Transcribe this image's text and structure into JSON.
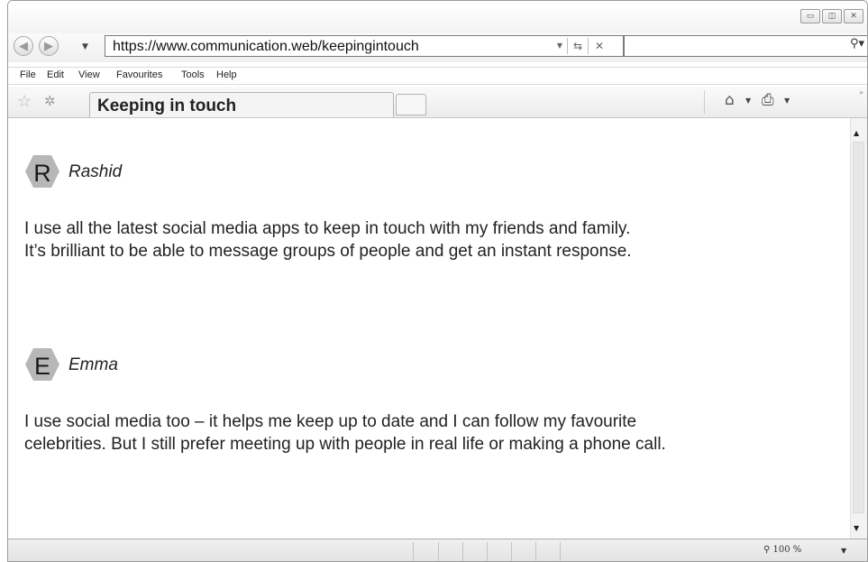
{
  "browser": {
    "address": {
      "url": "https://www.communication.web/keepingintouch",
      "search_value": ""
    },
    "menu": [
      "File",
      "Edit",
      "View",
      "Favourites",
      "Tools",
      "Help"
    ],
    "tab": {
      "title": "Keeping in touch"
    },
    "status": {
      "zoom": "100 %"
    },
    "icons": [
      "back-icon",
      "forward-icon",
      "dropdown-icon",
      "refresh-icon",
      "stop-icon",
      "search-icon",
      "favourites-star-icon",
      "add-favourite-icon",
      "home-icon",
      "print-icon",
      "zoom-icon",
      "minimize-icon",
      "maximize-icon",
      "close-icon"
    ]
  },
  "posts": [
    {
      "avatar_letter": "R",
      "author": "Rashid",
      "lines": [
        "I use all the latest social media apps to keep in touch with my friends and family.",
        "It’s brilliant to be able to message groups of people and get an instant response."
      ]
    },
    {
      "avatar_letter": "E",
      "author": "Emma",
      "lines": [
        "I use social media too – it helps me keep up to date and I can follow my favourite",
        "celebrities. But I still prefer meeting up with people in real life or making a phone call."
      ]
    }
  ],
  "colors": {
    "avatar_fill": "#b7b7b7",
    "avatar_letter": "#1a1a1a",
    "text": "#222222"
  }
}
